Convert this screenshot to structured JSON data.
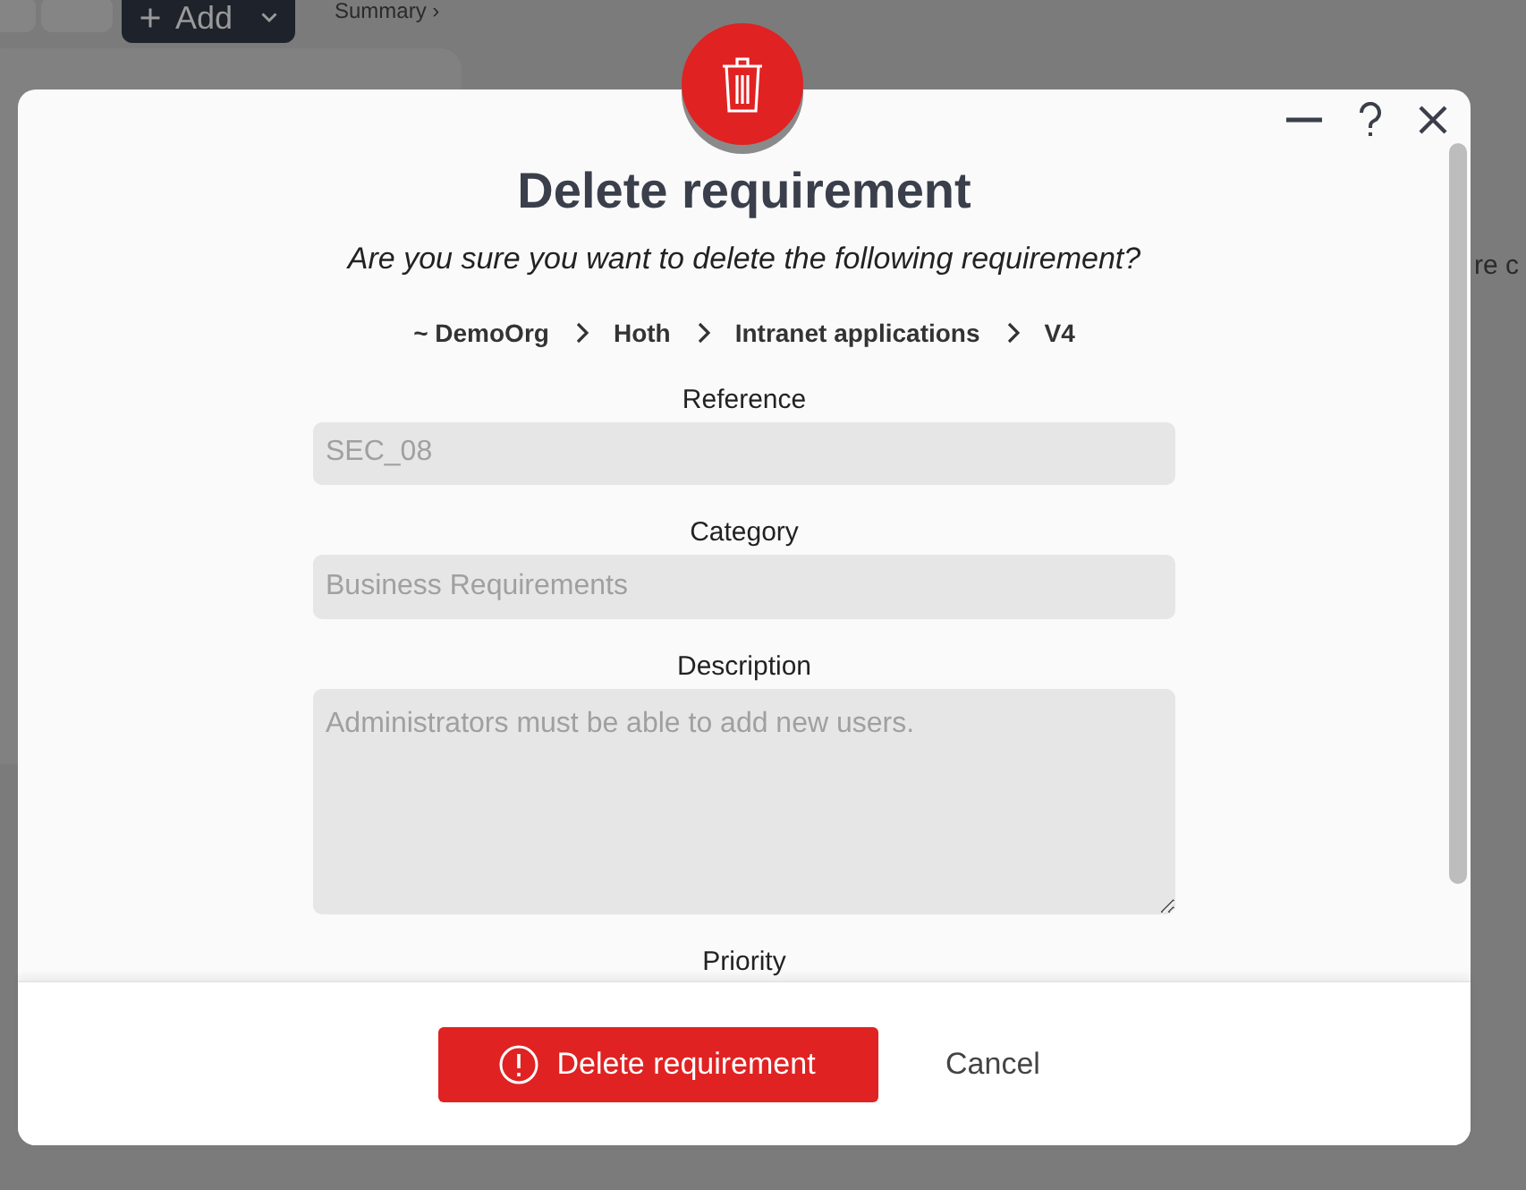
{
  "background": {
    "add_button": "Add",
    "breadcrumb": "Summary ›",
    "fragment_right": "re c"
  },
  "dialog": {
    "title": "Delete requirement",
    "question": "Are you sure you want to delete the following requirement?",
    "path": [
      "~ DemoOrg",
      "Hoth",
      "Intranet applications",
      "V4"
    ],
    "fields": [
      {
        "label": "Reference",
        "value": "SEC_08",
        "kind": "input"
      },
      {
        "label": "Category",
        "value": "Business Requirements",
        "kind": "input"
      },
      {
        "label": "Description",
        "value": "Administrators must be able to add new users.",
        "kind": "textarea"
      },
      {
        "label": "Priority",
        "kind": "hidden"
      }
    ],
    "buttons": [
      {
        "label": "Delete requirement",
        "kind": "danger"
      },
      {
        "label": "Cancel",
        "kind": "link"
      }
    ]
  }
}
